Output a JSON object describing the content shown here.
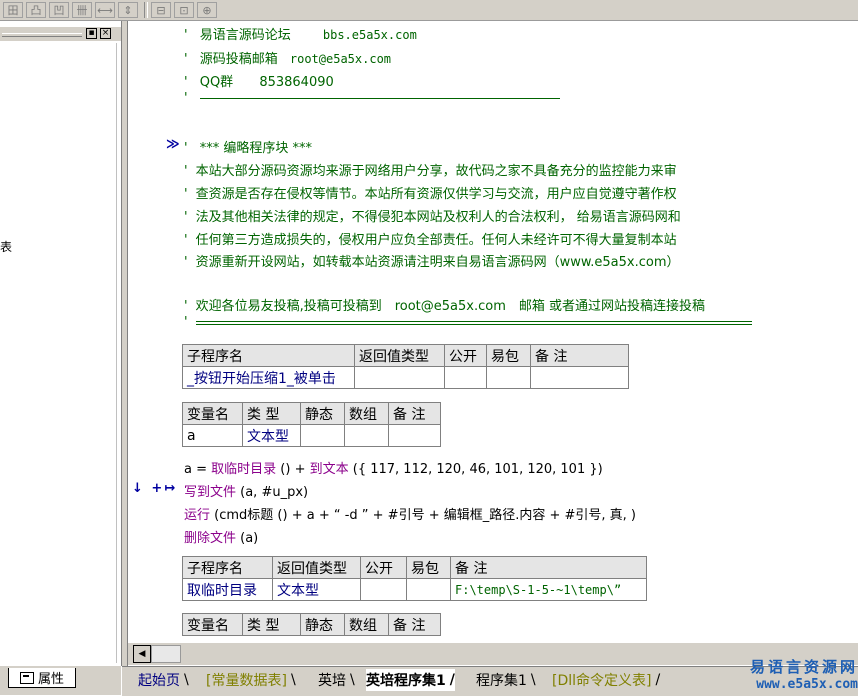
{
  "toolbar": {
    "buttons": [
      "田",
      "凸",
      "凹",
      "卌",
      "⟷",
      "⇕",
      "⊟",
      "⊡",
      "⊕"
    ]
  },
  "left_panel": {
    "mini_buttons": [
      "▪",
      "×"
    ],
    "edge_char": "表",
    "props_tab_label": "属性"
  },
  "code": {
    "header_lines": [
      {
        "marker": "'",
        "text": "易语言源码论坛",
        "extra": "bbs.e5a5x.com"
      },
      {
        "marker": "'",
        "text": "源码投稿邮箱",
        "extra": "root@e5a5x.com"
      },
      {
        "marker": "'",
        "text": "QQ群",
        "extra": "853864090"
      }
    ],
    "fold_marker": "≫",
    "block_title": "*** 编略程序块 ***",
    "notice_lines": [
      "本站大部分源码资源均来源于网络用户分享，故代码之家不具备充分的监控能力来审",
      "查资源是否存在侵权等情节。本站所有资源仅供学习与交流，用户应自觉遵守著作权",
      "法及其他相关法律的规定，不得侵犯本网站及权利人的合法权利， 给易语言源码网和",
      "任何第三方造成损失的，侵权用户应负全部责任。任何人未经许可不得大量复制本站",
      "资源重新开设网站，如转载本站资源请注明来自易语言源码网（www.e5a5x.com）"
    ],
    "welcome_line": "欢迎各位易友投稿,投稿可投稿到　root@e5a5x.com　邮箱 或者通过网站投稿连接投稿",
    "quote_mark": "'",
    "sub1": {
      "headers": [
        "子程序名",
        "返回值类型",
        "公开",
        "易包",
        "备 注"
      ],
      "row": [
        "_按钮开始压缩1_被单击",
        "",
        "",
        "",
        ""
      ]
    },
    "var1": {
      "headers": [
        "变量名",
        "类 型",
        "静态",
        "数组",
        "备 注"
      ],
      "row": [
        "a",
        "文本型",
        "",
        "",
        ""
      ]
    },
    "stmt1": {
      "var": "a",
      "eq": " = ",
      "fn": "取临时目录",
      "call": " () + ",
      "fn2": "到文本",
      "args": " ({ 117, 112, 120, 46, 101, 120, 101 })"
    },
    "cursor_markers": "↓ +↦",
    "stmt2": {
      "fn": "写到文件",
      "args": " (a, #u_px)"
    },
    "stmt3": {
      "fn": "运行",
      "args": " (cmd标题 () + a + “ -d ” + #引号 + 编辑框_路径.内容 + #引号, 真, )"
    },
    "stmt4": {
      "fn": "删除文件",
      "args": " (a)"
    },
    "sub2": {
      "headers": [
        "子程序名",
        "返回值类型",
        "公开",
        "易包",
        "备 注"
      ],
      "row": [
        "取临时目录",
        "文本型",
        "",
        "",
        "F:\\temp\\S-1-5-~1\\temp\\”"
      ]
    },
    "var2": {
      "headers": [
        "变量名",
        "类 型",
        "静态",
        "数组",
        "备 注"
      ]
    }
  },
  "hscroll": {
    "left_arrow": "◀"
  },
  "tabs": [
    {
      "label": "起始页"
    },
    {
      "label": "[常量数据表]"
    },
    {
      "label": "英培"
    },
    {
      "label": "英培程序集1"
    },
    {
      "label": "程序集1"
    },
    {
      "label": "[Dll命令定义表]"
    }
  ],
  "watermark": {
    "line1": "易语言资源网",
    "line2": "www.e5a5x.com"
  },
  "colors": {
    "comment": "#006400",
    "keyword": "#8b008b",
    "type": "#000080",
    "panel": "#d4d0c8"
  }
}
